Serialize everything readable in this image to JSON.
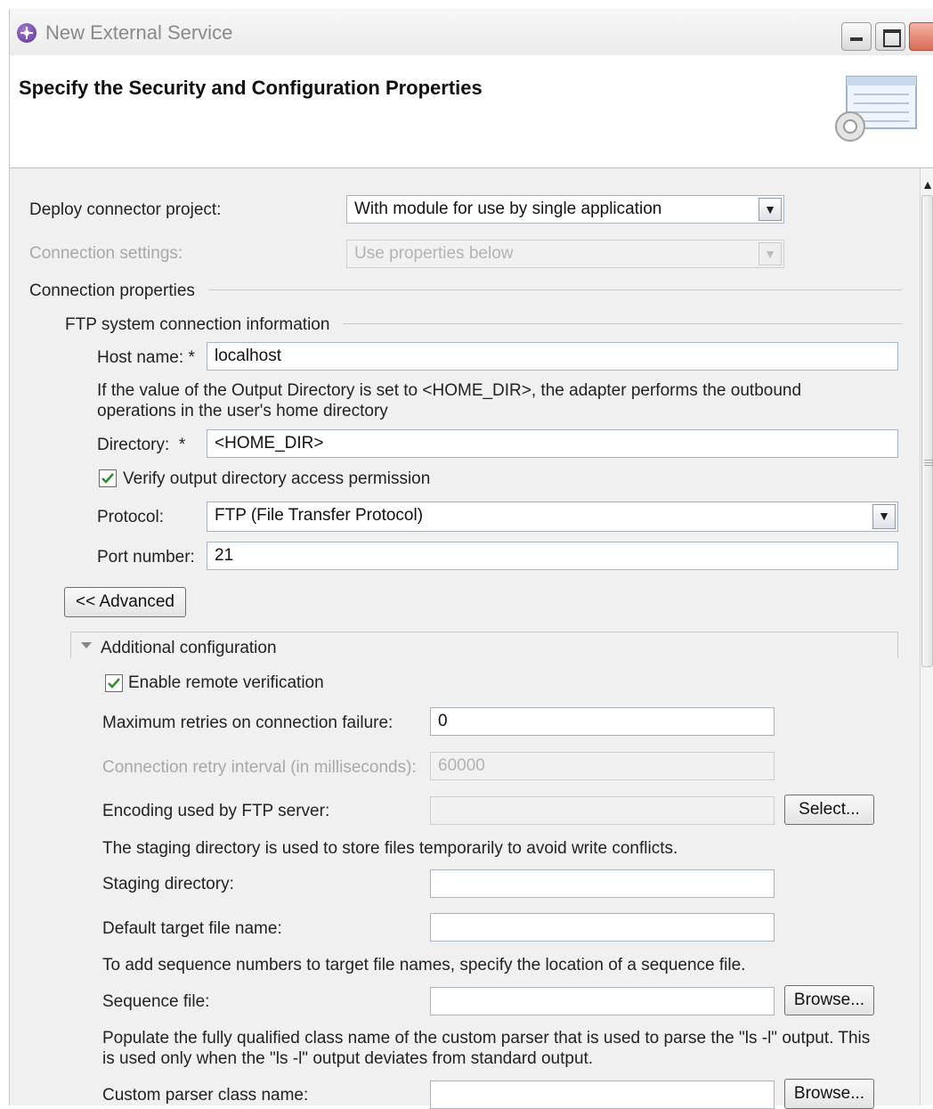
{
  "window": {
    "title": "New External Service"
  },
  "header": {
    "title": "Specify the Security and Configuration Properties"
  },
  "form": {
    "deploy_label": "Deploy connector project:",
    "deploy_value": "With module for use by single application",
    "conn_settings_label": "Connection settings:",
    "conn_settings_value": "Use properties below",
    "conn_properties_label": "Connection properties",
    "ftp_group_label": "FTP system connection information",
    "host_label": "Host name:",
    "host_value": "localhost",
    "output_dir_note": "If the value of the Output Directory is set to <HOME_DIR>, the adapter performs the outbound operations in the user's home directory",
    "directory_label": "Directory:",
    "directory_value": "<HOME_DIR>",
    "verify_label": "Verify output directory access permission",
    "protocol_label": "Protocol:",
    "protocol_value": "FTP (File Transfer Protocol)",
    "port_label": "Port number:",
    "port_value": "21",
    "advanced_button": "<< Advanced",
    "required_marker": "*"
  },
  "additional": {
    "section_label": "Additional configuration",
    "remote_verify_label": "Enable remote verification",
    "max_retries_label": "Maximum retries on connection failure:",
    "max_retries_value": "0",
    "retry_interval_label": "Connection retry interval (in milliseconds):",
    "retry_interval_value": "60000",
    "encoding_label": "Encoding used by FTP server:",
    "encoding_value": "",
    "select_button": "Select...",
    "staging_note": "The staging directory is used to store files temporarily to avoid write conflicts.",
    "staging_label": "Staging directory:",
    "staging_value": "",
    "default_target_label": "Default target file name:",
    "default_target_value": "",
    "sequence_note": "To add sequence numbers to target file names, specify the location of a sequence file.",
    "sequence_label": "Sequence file:",
    "sequence_value": "",
    "browse_button": "Browse...",
    "parser_note": "Populate the fully qualified class name of the custom parser that is used to parse the \"ls -l\" output. This is used only when the \"ls -l\" output deviates from standard output.",
    "parser_label": "Custom parser class name:",
    "parser_value": ""
  },
  "colors": {
    "accent": "#5a2f91",
    "check": "#2e8b2e"
  }
}
